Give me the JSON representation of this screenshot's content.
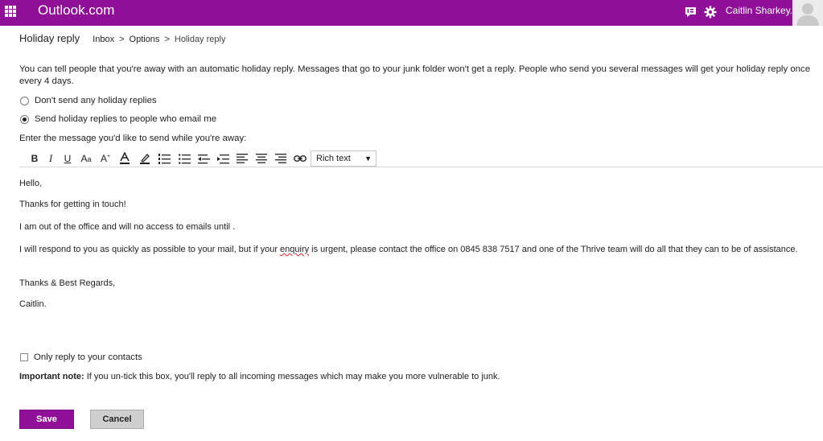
{
  "header": {
    "brand": "Outlook.com",
    "user_name": "Caitlin Sharkey.",
    "bg_color": "#8f0f97",
    "icons": [
      "app-launcher-icon",
      "chat-icon",
      "gear-icon",
      "avatar"
    ]
  },
  "subheader": {
    "title": "Holiday reply",
    "breadcrumb": [
      "Inbox",
      "Options",
      "Holiday reply"
    ],
    "separator": ">"
  },
  "intro": "You can tell people that you're away with an automatic holiday reply. Messages that go to your junk folder won't get a reply. People who send you several messages will get your holiday reply once every 4 days.",
  "options": [
    {
      "label": "Don't send any holiday replies",
      "checked": false
    },
    {
      "label": "Send holiday replies to people who email me",
      "checked": true
    }
  ],
  "message_label": "Enter the message you'd like to send while you're away:",
  "toolbar": {
    "buttons": [
      "bold-icon",
      "italic-icon",
      "underline-icon",
      "font-size-icon",
      "grow-font-icon",
      "font-color-icon",
      "highlight-icon",
      "numbered-list-icon",
      "bulleted-list-icon",
      "decrease-indent-icon",
      "increase-indent-icon",
      "align-left-icon",
      "align-center-icon",
      "align-right-icon",
      "link-icon"
    ],
    "format_select": "Rich text"
  },
  "message": {
    "greeting": "Hello,",
    "line1": "Thanks for getting in touch!",
    "line2": "I am out of the office and will no access to emails until .",
    "line3_part1": "I will respond to you as quickly as possible to your mail, but if your ",
    "line3_misspelled": "enquiry",
    "line3_part2": " is urgent, please contact the office on 0845 838 7517 and one of the Thrive team will do all that they can to be of assistance.",
    "signoff": "Thanks & Best Regards,",
    "signature": "Caitlin."
  },
  "contacts_only": {
    "label": "Only reply to your contacts",
    "checked": false
  },
  "note": {
    "bold": "Important note:",
    "text": " If you un-tick this box, you'll reply to all incoming messages which may make you more vulnerable to junk."
  },
  "actions": {
    "save": "Save",
    "cancel": "Cancel",
    "save_color": "#8f0f97"
  }
}
